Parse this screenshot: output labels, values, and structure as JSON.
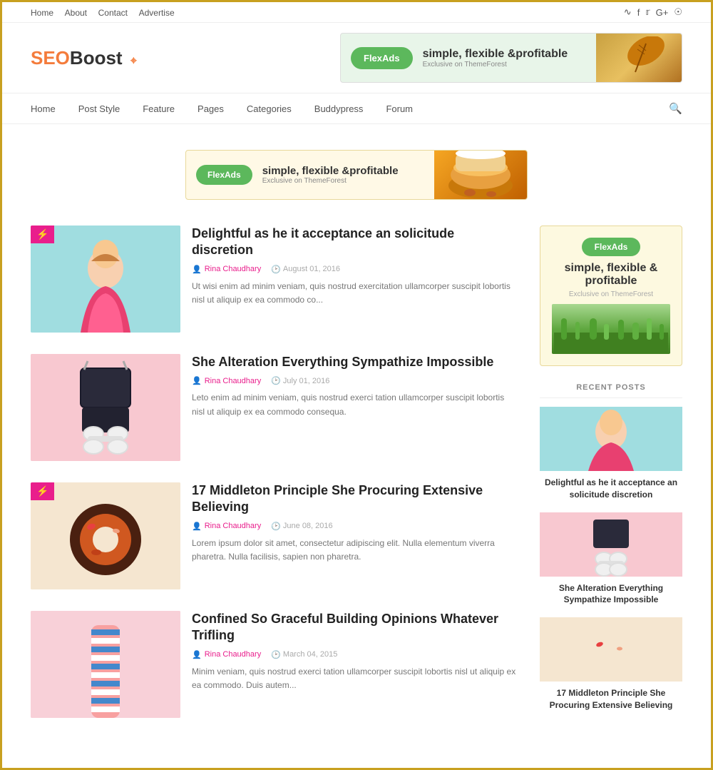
{
  "topnav": {
    "links": [
      "Home",
      "About",
      "Contact",
      "Advertise"
    ]
  },
  "logo": {
    "seo": "SEO",
    "boost": "Boost"
  },
  "mainnav": {
    "links": [
      "Home",
      "Post Style",
      "Feature",
      "Pages",
      "Categories",
      "Buddypress",
      "Forum"
    ]
  },
  "banner": {
    "flexads": "FlexAds",
    "main": "simple, flexible &profitable",
    "sub": "Exclusive on ThemeForest"
  },
  "posts": [
    {
      "id": 1,
      "title": "Delightful as he it acceptance an solicitude discretion",
      "author": "Rina Chaudhary",
      "date": "August 01, 2016",
      "excerpt": "Ut wisi enim ad minim veniam, quis nostrud exercitation ullamcorper suscipit lobortis nisl ut aliquip ex ea commodo co...",
      "featured": true
    },
    {
      "id": 2,
      "title": "She Alteration Everything Sympathize Impossible",
      "author": "Rina Chaudhary",
      "date": "July 01, 2016",
      "excerpt": "Leto enim ad minim veniam, quis nostrud exerci tation ullamcorper suscipit lobortis nisl ut aliquip ex ea commodo consequa.",
      "featured": false
    },
    {
      "id": 3,
      "title": "17 Middleton Principle She Procuring Extensive Believing",
      "author": "Rina Chaudhary",
      "date": "June 08, 2016",
      "excerpt": "Lorem ipsum dolor sit amet, consectetur adipiscing elit. Nulla elementum viverra pharetra. Nulla facilisis, sapien non pharetra.",
      "featured": true
    },
    {
      "id": 4,
      "title": "Confined So Graceful Building Opinions Whatever Trifling",
      "author": "Rina Chaudhary",
      "date": "March 04, 2015",
      "excerpt": "Minim veniam, quis nostrud exerci tation ullamcorper suscipit lobortis nisl ut aliquip ex ea commodo. Duis autem...",
      "featured": false
    }
  ],
  "sidebar": {
    "ad": {
      "flexads": "FlexAds",
      "main": "simple, flexible & profitable",
      "sub": "Exclusive on ThemeForest"
    },
    "recent_posts_title": "RECENT POSTS",
    "recent_posts": [
      {
        "title": "Delightful as he it acceptance an solicitude discretion"
      },
      {
        "title": "She Alteration Everything Sympathize Impossible"
      },
      {
        "title": "17 Middleton Principle She Procuring Extensive Believing"
      }
    ]
  }
}
